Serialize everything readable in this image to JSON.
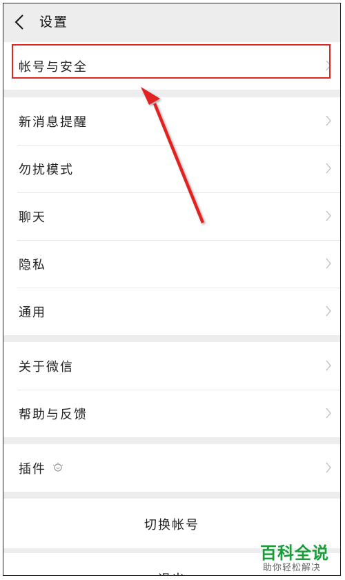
{
  "header": {
    "title": "设置"
  },
  "groups": [
    {
      "items": [
        {
          "label": "帐号与安全"
        }
      ]
    },
    {
      "items": [
        {
          "label": "新消息提醒"
        },
        {
          "label": "勿扰模式"
        },
        {
          "label": "聊天"
        },
        {
          "label": "隐私"
        },
        {
          "label": "通用"
        }
      ]
    },
    {
      "items": [
        {
          "label": "关于微信"
        },
        {
          "label": "帮助与反馈"
        }
      ]
    },
    {
      "items": [
        {
          "label": "插件"
        }
      ]
    }
  ],
  "actions": {
    "switch_account": "切换帐号",
    "logout": "退出"
  },
  "annotation": {
    "color": "#e02323"
  },
  "watermark": {
    "main": "百科全说",
    "sub": "助你轻松解决"
  },
  "icons": {
    "back": "chevron-left-icon",
    "row": "chevron-right-icon",
    "plugin": "plugin-bulb-icon"
  }
}
